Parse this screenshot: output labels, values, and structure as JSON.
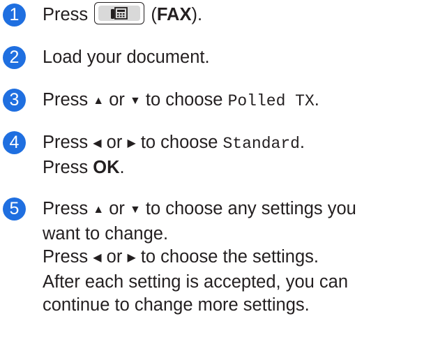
{
  "steps": [
    {
      "number": "1",
      "parts": {
        "press": "Press",
        "space": " ",
        "paren_open": " (",
        "fax": "FAX",
        "paren_close": ")."
      },
      "icons": [
        "fax-key-icon"
      ]
    },
    {
      "number": "2",
      "text": "Load your document."
    },
    {
      "number": "3",
      "parts": {
        "press": "Press ",
        "up_arrow": "▲",
        "or": " or ",
        "down_arrow": "▼",
        "to_choose": " to choose ",
        "option": "Polled TX",
        "period": "."
      }
    },
    {
      "number": "4",
      "parts": {
        "press": "Press ",
        "left_arrow": "◀",
        "or": " or ",
        "right_arrow": "▶",
        "to_choose": " to choose ",
        "option": "Standard",
        "period": ".",
        "press2": "Press ",
        "ok": "OK",
        "period2": "."
      }
    },
    {
      "number": "5",
      "parts": {
        "press": "Press ",
        "up_arrow": "▲",
        "or": " or ",
        "down_arrow": "▼",
        "to_choose_any": " to choose any settings you",
        "line2": "want to change.",
        "press2": "Press ",
        "left_arrow": "◀",
        "or2": " or ",
        "right_arrow": "▶",
        "to_choose_settings": " to choose the settings.",
        "line4": "After each setting is accepted, you can",
        "line5": "continue to change more settings."
      }
    }
  ],
  "colors": {
    "step_badge": "#1f6fe0",
    "text": "#231f20",
    "key_fill": "#d9d9d9"
  }
}
